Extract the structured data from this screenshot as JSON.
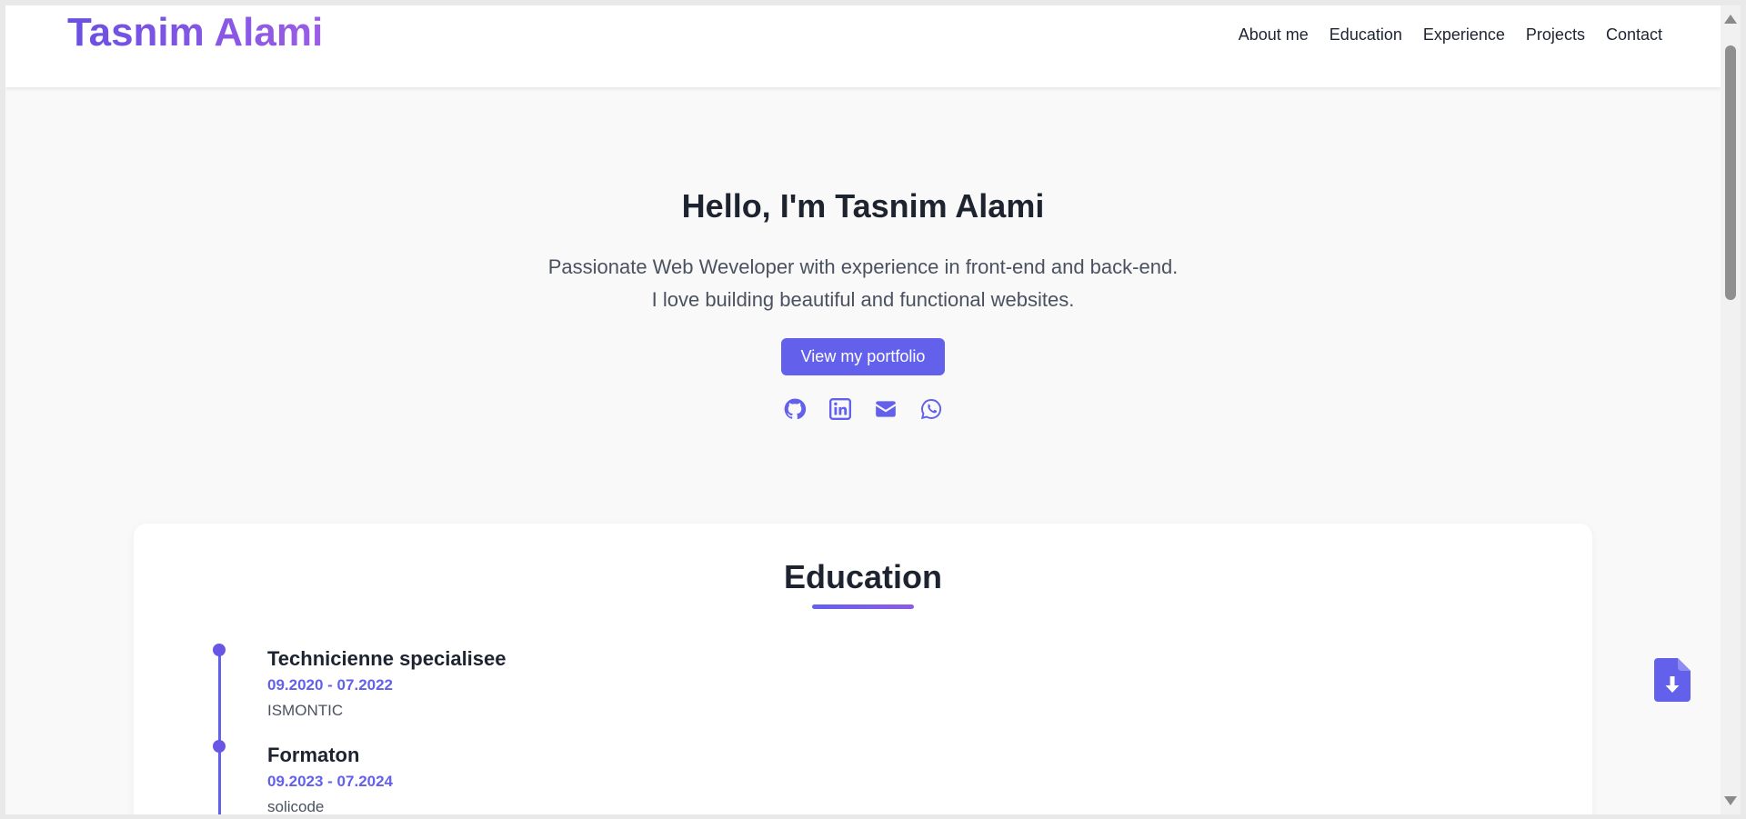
{
  "navbar": {
    "brand": "Tasnim Alami",
    "links": [
      "About me",
      "Education",
      "Experience",
      "Projects",
      "Contact"
    ]
  },
  "hero": {
    "title": "Hello, I'm Tasnim Alami",
    "subtitle_line1": "Passionate Web Weveloper with experience in front-end and back-end.",
    "subtitle_line2": "I love building beautiful and functional websites.",
    "cta_label": "View my portfolio",
    "socials": [
      "github-icon",
      "linkedin-icon",
      "mail-icon",
      "whatsapp-icon"
    ]
  },
  "education": {
    "title": "Education",
    "items": [
      {
        "title": "Technicienne specialisee",
        "date": "09.2020 - 07.2022",
        "school": "ISMONTIC"
      },
      {
        "title": "Formaton",
        "date": "09.2023 - 07.2024",
        "school": "solicode"
      }
    ]
  },
  "colors": {
    "accent": "#6361ec",
    "brand_start": "#6a4fe2",
    "brand_end": "#9b5de5",
    "text_dark": "#1e2330",
    "text_muted": "#4a5160",
    "page_bg": "#f9f9f9"
  },
  "download_button": {
    "icon": "file-download-icon"
  }
}
